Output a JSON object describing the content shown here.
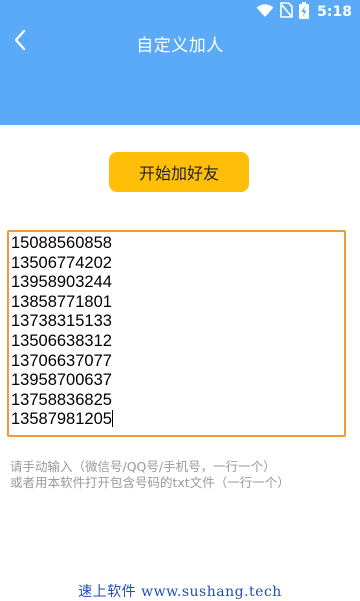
{
  "status_bar": {
    "time": "5:18",
    "icons": [
      "wifi-icon",
      "sim-no-signal-icon",
      "battery-charging-icon"
    ]
  },
  "app_bar": {
    "back_icon": "chevron-left-icon",
    "title": "自定义加人"
  },
  "action": {
    "start_label": "开始加好友"
  },
  "numbers": [
    "15088560858",
    "13506774202",
    "13958903244",
    "13858771801",
    "13738315133",
    "13506638312",
    "13706637077",
    "13958700637",
    "13758836825",
    "13587981205"
  ],
  "hint": {
    "line1": "请手动输入（微信号/QQ号/手机号，一行一个）",
    "line2": "或者用本软件打开包含号码的txt文件（一行一个）"
  },
  "footer": {
    "watermark": "速上软件 www.sushang.tech"
  },
  "colors": {
    "app_bar": "#5AAAF8",
    "button": "#FFBF08",
    "input_border": "#F29A33",
    "hint_text": "#9A9A9A",
    "watermark": "#1E4FB5"
  }
}
